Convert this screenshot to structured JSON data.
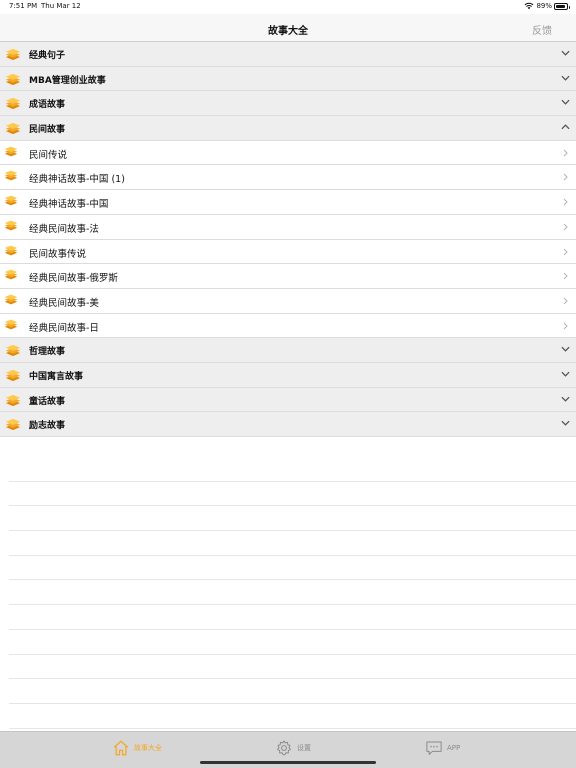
{
  "status": {
    "time": "7:51 PM",
    "date": "Thu Mar 12",
    "battery_text": "89%",
    "battery_level": 0.89
  },
  "navbar": {
    "title": "故事大全",
    "feedback_label": "反馈"
  },
  "list": {
    "rows": [
      {
        "type": "group",
        "label": "经典句子",
        "expanded": false
      },
      {
        "type": "group",
        "label": "MBA管理创业故事",
        "expanded": false
      },
      {
        "type": "group",
        "label": "成语故事",
        "expanded": false
      },
      {
        "type": "group",
        "label": "民间故事",
        "expanded": true
      },
      {
        "type": "child",
        "label": "民间传说"
      },
      {
        "type": "child",
        "label": "经典神话故事-中国 (1)"
      },
      {
        "type": "child",
        "label": "经典神话故事-中国"
      },
      {
        "type": "child",
        "label": "经典民间故事-法"
      },
      {
        "type": "child",
        "label": "民间故事传说"
      },
      {
        "type": "child",
        "label": "经典民间故事-俄罗斯"
      },
      {
        "type": "child",
        "label": "经典民间故事-美"
      },
      {
        "type": "child",
        "label": "经典民间故事-日"
      },
      {
        "type": "group",
        "label": "哲理故事",
        "expanded": false
      },
      {
        "type": "group",
        "label": "中国寓言故事",
        "expanded": false
      },
      {
        "type": "group",
        "label": "童话故事",
        "expanded": false
      },
      {
        "type": "group",
        "label": "励志故事",
        "expanded": false
      }
    ]
  },
  "tabbar": {
    "tabs": [
      {
        "name": "home",
        "label": "故事大全",
        "icon": "home-icon",
        "active": true
      },
      {
        "name": "settings",
        "label": "设置",
        "icon": "gear-icon",
        "active": false
      },
      {
        "name": "app",
        "label": "APP",
        "icon": "chat-bubble-icon",
        "active": false
      }
    ]
  },
  "colors": {
    "accent": "#f5a623",
    "group_bg": "#eeeeef",
    "tab_inactive": "#8a8a8a"
  }
}
